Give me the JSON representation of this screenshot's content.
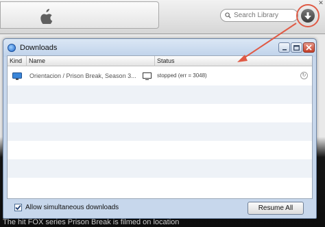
{
  "itunes": {
    "search": {
      "placeholder": "Search Library",
      "value": ""
    },
    "caption": "The hit FOX series Prison Break is filmed on location"
  },
  "downloads_window": {
    "title": "Downloads",
    "columns": {
      "kind": "Kind",
      "name": "Name",
      "status": "Status"
    },
    "rows": [
      {
        "kind_icon": "monitor-icon",
        "name": "Orientacion / Prison Break, Season 3...",
        "device_icon": "tv-icon",
        "status": "stopped (err = 3048)"
      }
    ],
    "allow_simultaneous": {
      "label": "Allow simultaneous downloads",
      "checked": true
    },
    "resume_all": "Resume All"
  },
  "colors": {
    "annotation": "#e05a45",
    "window_frame": "#c7d7ec",
    "close_button": "#c4402a"
  }
}
